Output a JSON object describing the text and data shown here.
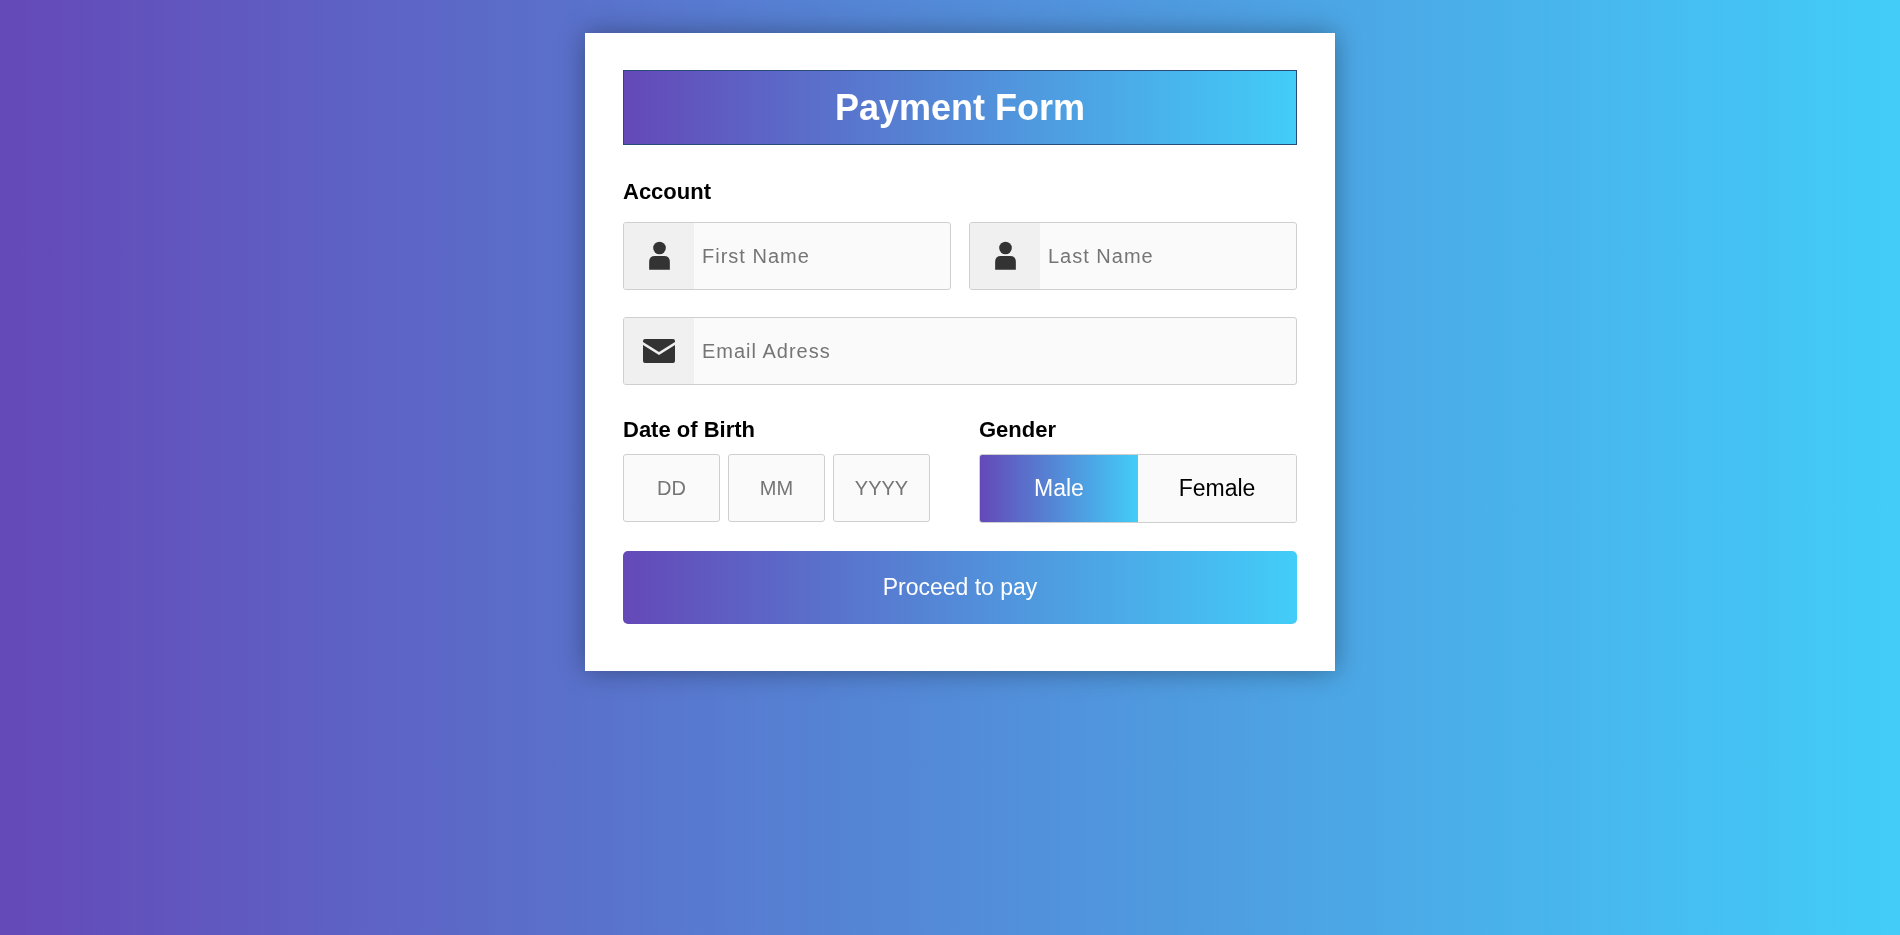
{
  "form": {
    "title": "Payment Form",
    "account": {
      "label": "Account",
      "first_name": {
        "placeholder": "First Name"
      },
      "last_name": {
        "placeholder": "Last Name"
      },
      "email": {
        "placeholder": "Email Adress"
      }
    },
    "date_of_birth": {
      "label": "Date of Birth",
      "fields": [
        {
          "placeholder": "DD"
        },
        {
          "placeholder": "MM"
        },
        {
          "placeholder": "YYYY"
        }
      ]
    },
    "gender": {
      "label": "Gender",
      "options": [
        {
          "label": "Male",
          "selected": true
        },
        {
          "label": "Female",
          "selected": false
        }
      ]
    },
    "submit": "Proceed to pay"
  }
}
